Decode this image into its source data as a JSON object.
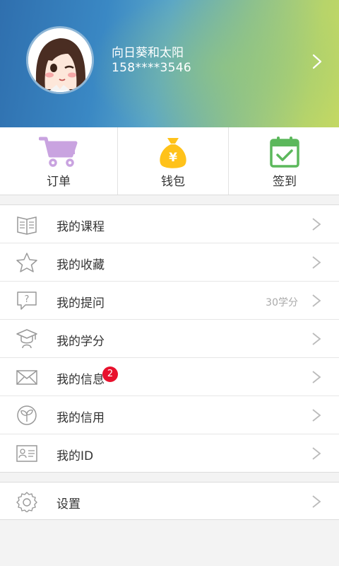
{
  "profile": {
    "name": "向日葵和太阳",
    "phone": "158****3546",
    "avatar_icon": "cartoon-girl-avatar"
  },
  "quick_actions": [
    {
      "label": "订单",
      "icon": "shopping-cart-icon",
      "color": "#c9a3e0"
    },
    {
      "label": "钱包",
      "icon": "money-bag-icon",
      "color": "#ffc21a"
    },
    {
      "label": "签到",
      "icon": "calendar-check-icon",
      "color": "#5cb85c"
    }
  ],
  "menu": [
    {
      "label": "我的课程",
      "icon": "book-icon"
    },
    {
      "label": "我的收藏",
      "icon": "star-icon"
    },
    {
      "label": "我的提问",
      "icon": "question-bubble-icon",
      "extra": "30学分"
    },
    {
      "label": "我的学分",
      "icon": "graduation-cap-icon"
    },
    {
      "label": "我的信息",
      "icon": "envelope-icon",
      "badge": "2"
    },
    {
      "label": "我的信用",
      "icon": "sprout-icon"
    },
    {
      "label": "我的ID",
      "icon": "id-card-icon"
    }
  ],
  "settings": {
    "label": "设置",
    "icon": "gear-icon"
  },
  "colors": {
    "badge": "#e8112d",
    "header_start": "#2f6fae",
    "header_end": "#c3d863"
  }
}
